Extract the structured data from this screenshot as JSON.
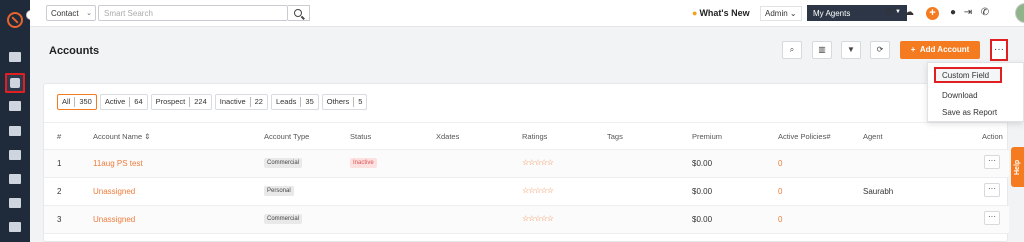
{
  "topbar": {
    "context_select": "Contact",
    "search_placeholder": "Smart Search",
    "whats_new": "What's New",
    "admin_select": "Admin",
    "agents_select": "My Agents"
  },
  "page": {
    "title": "Accounts",
    "add_button": "Add Account",
    "more_button": "···"
  },
  "dropdown": {
    "items": [
      "Custom Field",
      "Download",
      "Save as Report"
    ]
  },
  "filters": [
    {
      "label": "All",
      "count": "350"
    },
    {
      "label": "Active",
      "count": "64"
    },
    {
      "label": "Prospect",
      "count": "224"
    },
    {
      "label": "Inactive",
      "count": "22"
    },
    {
      "label": "Leads",
      "count": "35"
    },
    {
      "label": "Others",
      "count": "5"
    }
  ],
  "table": {
    "headers": [
      "#",
      "Account Name ⇕",
      "Account Type",
      "Status",
      "Xdates",
      "Ratings",
      "Tags",
      "Premium",
      "Active Policies#",
      "Agent",
      "Action"
    ],
    "rows": [
      {
        "num": "1",
        "name": "11aug PS test",
        "type": "Commercial",
        "status": "Inactive",
        "rating": "☆☆☆☆☆",
        "premium": "$0.00",
        "policies": "0",
        "agent": ""
      },
      {
        "num": "2",
        "name": "Unassigned",
        "type": "Personal",
        "status": "",
        "rating": "☆☆☆☆☆",
        "premium": "$0.00",
        "policies": "0",
        "agent": "Saurabh"
      },
      {
        "num": "3",
        "name": "Unassigned",
        "type": "Commercial",
        "status": "",
        "rating": "☆☆☆☆☆",
        "premium": "$0.00",
        "policies": "0",
        "agent": ""
      }
    ]
  },
  "help_tab": "Help",
  "colors": {
    "accent": "#f47b20",
    "sidebar": "#1f2a3a",
    "highlight": "#e02020"
  }
}
